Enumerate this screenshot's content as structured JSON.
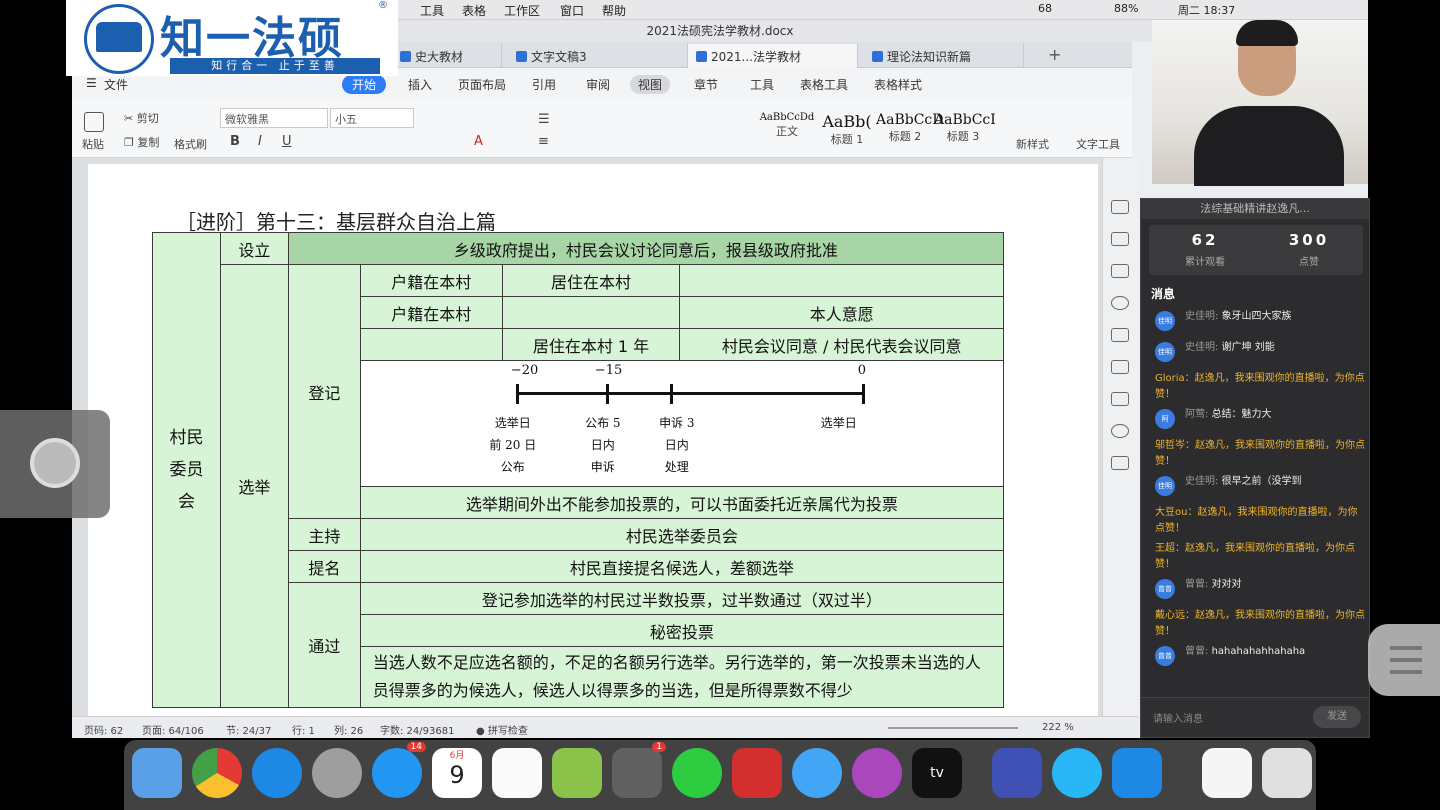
{
  "menubar": {
    "items": [
      "工具",
      "表格",
      "工作区",
      "窗口",
      "帮助"
    ],
    "status": {
      "battery": "88%",
      "time": "周二 18:37",
      "notif": "68"
    }
  },
  "window_title": "2021法硕宪法学教材.docx",
  "tabs": [
    {
      "label": "史大教材"
    },
    {
      "label": "文字文稿3"
    },
    {
      "label": "2021...法学教材"
    },
    {
      "label": "理论法知识新篇"
    }
  ],
  "ribbon_tabs": [
    "文件",
    "开始",
    "插入",
    "页面布局",
    "引用",
    "审阅",
    "视图",
    "章节",
    "工具",
    "表格工具",
    "表格样式"
  ],
  "toolbar": {
    "paste": "粘贴",
    "cut": "剪切",
    "copy": "复制",
    "format_painter": "格式刷",
    "font": "微软雅黑",
    "size": "小五",
    "new_style": "新样式",
    "text_tool": "文字工具",
    "styles": [
      {
        "sample": "AaBbCcDd",
        "name": "正文"
      },
      {
        "sample": "AaBb(",
        "name": "标题 1"
      },
      {
        "sample": "AaBbCcD",
        "name": "标题 2"
      },
      {
        "sample": "AaBbCcI",
        "name": "标题 3"
      }
    ]
  },
  "logo": {
    "name": "知一法硕",
    "slogan": "知行合一 止于至善"
  },
  "doc": {
    "heading": "［进阶］第十三：基层群众自治上篇",
    "table": {
      "col1": "村民委员会",
      "setup_label": "设立",
      "setup_text": "乡级政府提出，村民会议讨论同意后，报县级政府批准",
      "election": "选举",
      "register": "登记",
      "reg_rows": [
        [
          "户籍在本村",
          "居住在本村",
          ""
        ],
        [
          "户籍在本村",
          "",
          "本人意愿"
        ],
        [
          "",
          "居住在本村 1 年",
          "村民会议同意 / 村民代表会议同意"
        ]
      ],
      "timeline": {
        "nums": [
          "−20",
          "−15",
          "0"
        ],
        "labels": [
          [
            "选举日",
            "前 20 日",
            "公布"
          ],
          [
            "公布 5",
            "日内",
            "申诉"
          ],
          [
            "申诉 3",
            "日内",
            "处理"
          ],
          [
            "选举日"
          ]
        ]
      },
      "absent_vote": "选举期间外出不能参加投票的，可以书面委托近亲属代为投票",
      "host_label": "主持",
      "host_text": "村民选举委员会",
      "nominate_label": "提名",
      "nominate_text": "村民直接提名候选人，差额选举",
      "pass_label": "通过",
      "pass_rows": [
        "登记参加选举的村民过半数投票，过半数通过（双过半）",
        "秘密投票",
        "当选人数不足应选名额的，不足的名额另行选举。另行选举的，第一次投票未当选的人员得票多的为候选人，候选人以得票多的当选，但是所得票数不得少"
      ]
    }
  },
  "statusbar": {
    "page_num": "页码: 62",
    "page": "页面: 64/106",
    "section": "节: 24/37",
    "row": "行: 1",
    "col": "列: 26",
    "words": "字数: 24/93681",
    "spell": "拼写检查",
    "zoom": "222 %"
  },
  "live": {
    "title": "法综基础精讲赵逸凡...",
    "watch_count": "62",
    "watch_label": "累计观看",
    "like_count": "300",
    "like_label": "点赞",
    "messages_label": "消息",
    "messages": [
      {
        "type": "user",
        "av": "佳明",
        "user": "史佳明:",
        "text": "象牙山四大家族"
      },
      {
        "type": "user",
        "av": "佳明",
        "user": "史佳明:",
        "text": "谢广坤 刘能"
      },
      {
        "type": "gift",
        "text": "Gloria：赵逸凡，我来围观你的直播啦，为你点赞！"
      },
      {
        "type": "user",
        "av": "阿",
        "user": "阿莺:",
        "text": "总结：魅力大"
      },
      {
        "type": "gift",
        "text": "邬哲岑：赵逸凡，我来围观你的直播啦，为你点赞！"
      },
      {
        "type": "user",
        "av": "佳明",
        "user": "史佳明:",
        "text": "很早之前（没学到"
      },
      {
        "type": "gift",
        "text": "大豆ou：赵逸凡，我来围观你的直播啦，为你点赞！"
      },
      {
        "type": "gift",
        "text": "王超：赵逸凡，我来围观你的直播啦，为你点赞！"
      },
      {
        "type": "user",
        "av": "曾曾",
        "user": "曾曾:",
        "text": "对对对"
      },
      {
        "type": "gift",
        "text": "戴心远：赵逸凡，我来围观你的直播啦，为你点赞！"
      },
      {
        "type": "user",
        "av": "曾曾",
        "user": "曾曾:",
        "text": "hahahahahhahaha"
      }
    ],
    "input_placeholder": "请输入消息",
    "send": "发送"
  },
  "dock": {
    "calendar_month": "6月",
    "calendar_day": "9",
    "badge_appstore": "14",
    "badge_settings": "1",
    "tv": "tv"
  }
}
